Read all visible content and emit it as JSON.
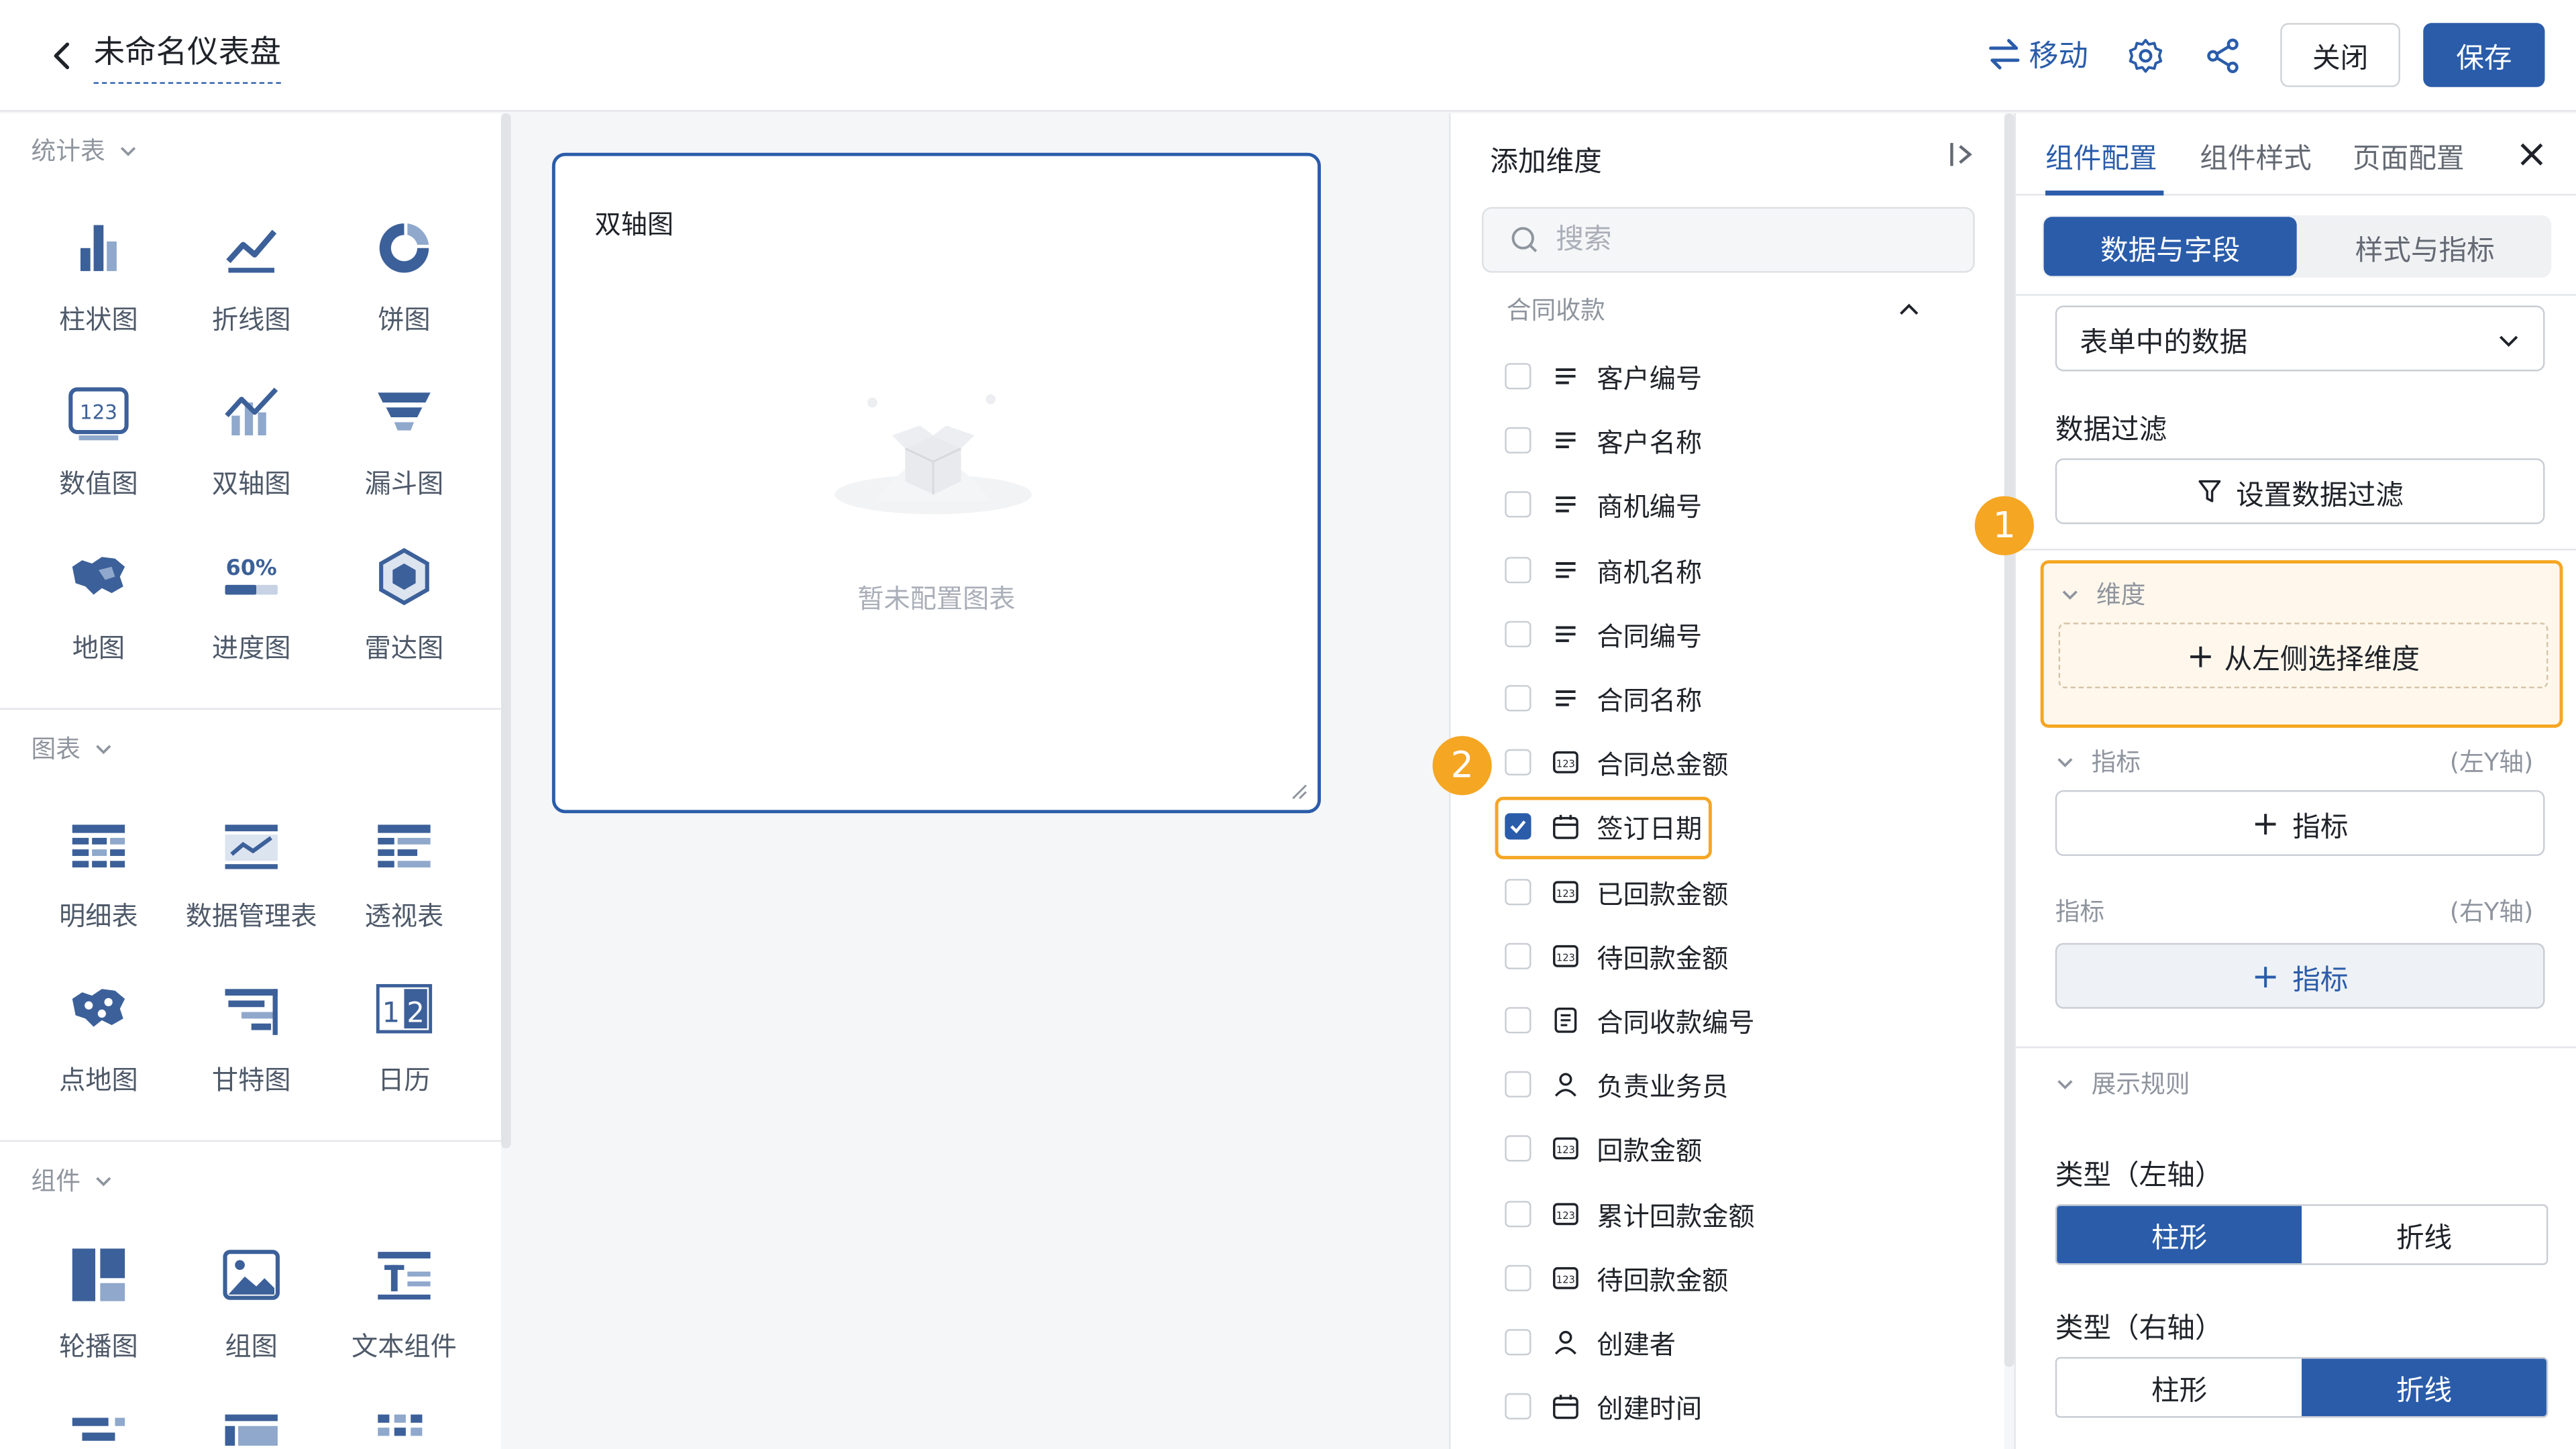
{
  "header": {
    "title": "未命名仪表盘",
    "move_label": "移动",
    "close_label": "关闭",
    "save_label": "保存"
  },
  "left_panel": {
    "sections": [
      {
        "title": "统计表",
        "items": [
          {
            "label": "柱状图",
            "icon": "bar-chart-icon"
          },
          {
            "label": "折线图",
            "icon": "line-chart-icon"
          },
          {
            "label": "饼图",
            "icon": "pie-chart-icon"
          },
          {
            "label": "数值图",
            "icon": "number-chart-icon"
          },
          {
            "label": "双轴图",
            "icon": "dual-axis-chart-icon"
          },
          {
            "label": "漏斗图",
            "icon": "funnel-chart-icon"
          },
          {
            "label": "地图",
            "icon": "map-chart-icon"
          },
          {
            "label": "进度图",
            "icon": "progress-chart-icon",
            "text": "60%"
          },
          {
            "label": "雷达图",
            "icon": "radar-chart-icon"
          }
        ]
      },
      {
        "title": "图表",
        "items": [
          {
            "label": "明细表",
            "icon": "detail-table-icon"
          },
          {
            "label": "数据管理表",
            "icon": "data-management-table-icon"
          },
          {
            "label": "透视表",
            "icon": "pivot-table-icon"
          },
          {
            "label": "点地图",
            "icon": "point-map-icon"
          },
          {
            "label": "甘特图",
            "icon": "gantt-chart-icon"
          },
          {
            "label": "日历",
            "icon": "calendar-icon"
          }
        ]
      },
      {
        "title": "组件",
        "items": [
          {
            "label": "轮播图",
            "icon": "carousel-icon"
          },
          {
            "label": "组图",
            "icon": "image-group-icon"
          },
          {
            "label": "文本组件",
            "icon": "text-component-icon"
          }
        ]
      }
    ]
  },
  "canvas": {
    "card_title": "双轴图",
    "empty_text": "暂未配置图表"
  },
  "dimension_panel": {
    "title": "添加维度",
    "search_placeholder": "搜索",
    "group": "合同收款",
    "fields": [
      {
        "label": "客户编号",
        "icon": "text-field-icon",
        "checked": false
      },
      {
        "label": "客户名称",
        "icon": "text-field-icon",
        "checked": false
      },
      {
        "label": "商机编号",
        "icon": "text-field-icon",
        "checked": false
      },
      {
        "label": "商机名称",
        "icon": "text-field-icon",
        "checked": false
      },
      {
        "label": "合同编号",
        "icon": "text-field-icon",
        "checked": false
      },
      {
        "label": "合同名称",
        "icon": "text-field-icon",
        "checked": false
      },
      {
        "label": "合同总金额",
        "icon": "number-field-icon",
        "checked": false
      },
      {
        "label": "签订日期",
        "icon": "date-field-icon",
        "checked": true
      },
      {
        "label": "已回款金额",
        "icon": "number-field-icon",
        "checked": false
      },
      {
        "label": "待回款金额",
        "icon": "number-field-icon",
        "checked": false
      },
      {
        "label": "合同收款编号",
        "icon": "serial-field-icon",
        "checked": false
      },
      {
        "label": "负责业务员",
        "icon": "user-field-icon",
        "checked": false
      },
      {
        "label": "回款金额",
        "icon": "number-field-icon",
        "checked": false
      },
      {
        "label": "累计回款金额",
        "icon": "number-field-icon",
        "checked": false
      },
      {
        "label": "待回款金额",
        "icon": "number-field-icon",
        "checked": false
      },
      {
        "label": "创建者",
        "icon": "user-field-icon",
        "checked": false
      },
      {
        "label": "创建时间",
        "icon": "date-field-icon",
        "checked": false
      }
    ]
  },
  "right_panel": {
    "tabs": [
      "组件配置",
      "组件样式",
      "页面配置"
    ],
    "active_tab": "组件配置",
    "segments": [
      "数据与字段",
      "样式与指标"
    ],
    "data_source": "表单中的数据",
    "data_filter_label": "数据过滤",
    "data_filter_button": "设置数据过滤",
    "dimension_label": "维度",
    "dimension_drop": "从左侧选择维度",
    "metric_left_label": "指标",
    "metric_left_axis": "(左Y轴)",
    "metric_button_left": "指标",
    "metric_right_label": "指标",
    "metric_right_axis": "(右Y轴)",
    "metric_button_right": "指标",
    "display_rules": "展示规则",
    "type_left_label": "类型（左轴）",
    "type_left_options": [
      "柱形",
      "折线"
    ],
    "type_left_selected": "柱形",
    "type_right_label": "类型（右轴）",
    "type_right_options": [
      "柱形",
      "折线"
    ],
    "type_right_selected": "折线"
  },
  "markers": [
    "1",
    "2"
  ],
  "colors": {
    "primary": "#2a5caa",
    "highlight": "#f5a623",
    "icon_blue": "#3c6099"
  }
}
